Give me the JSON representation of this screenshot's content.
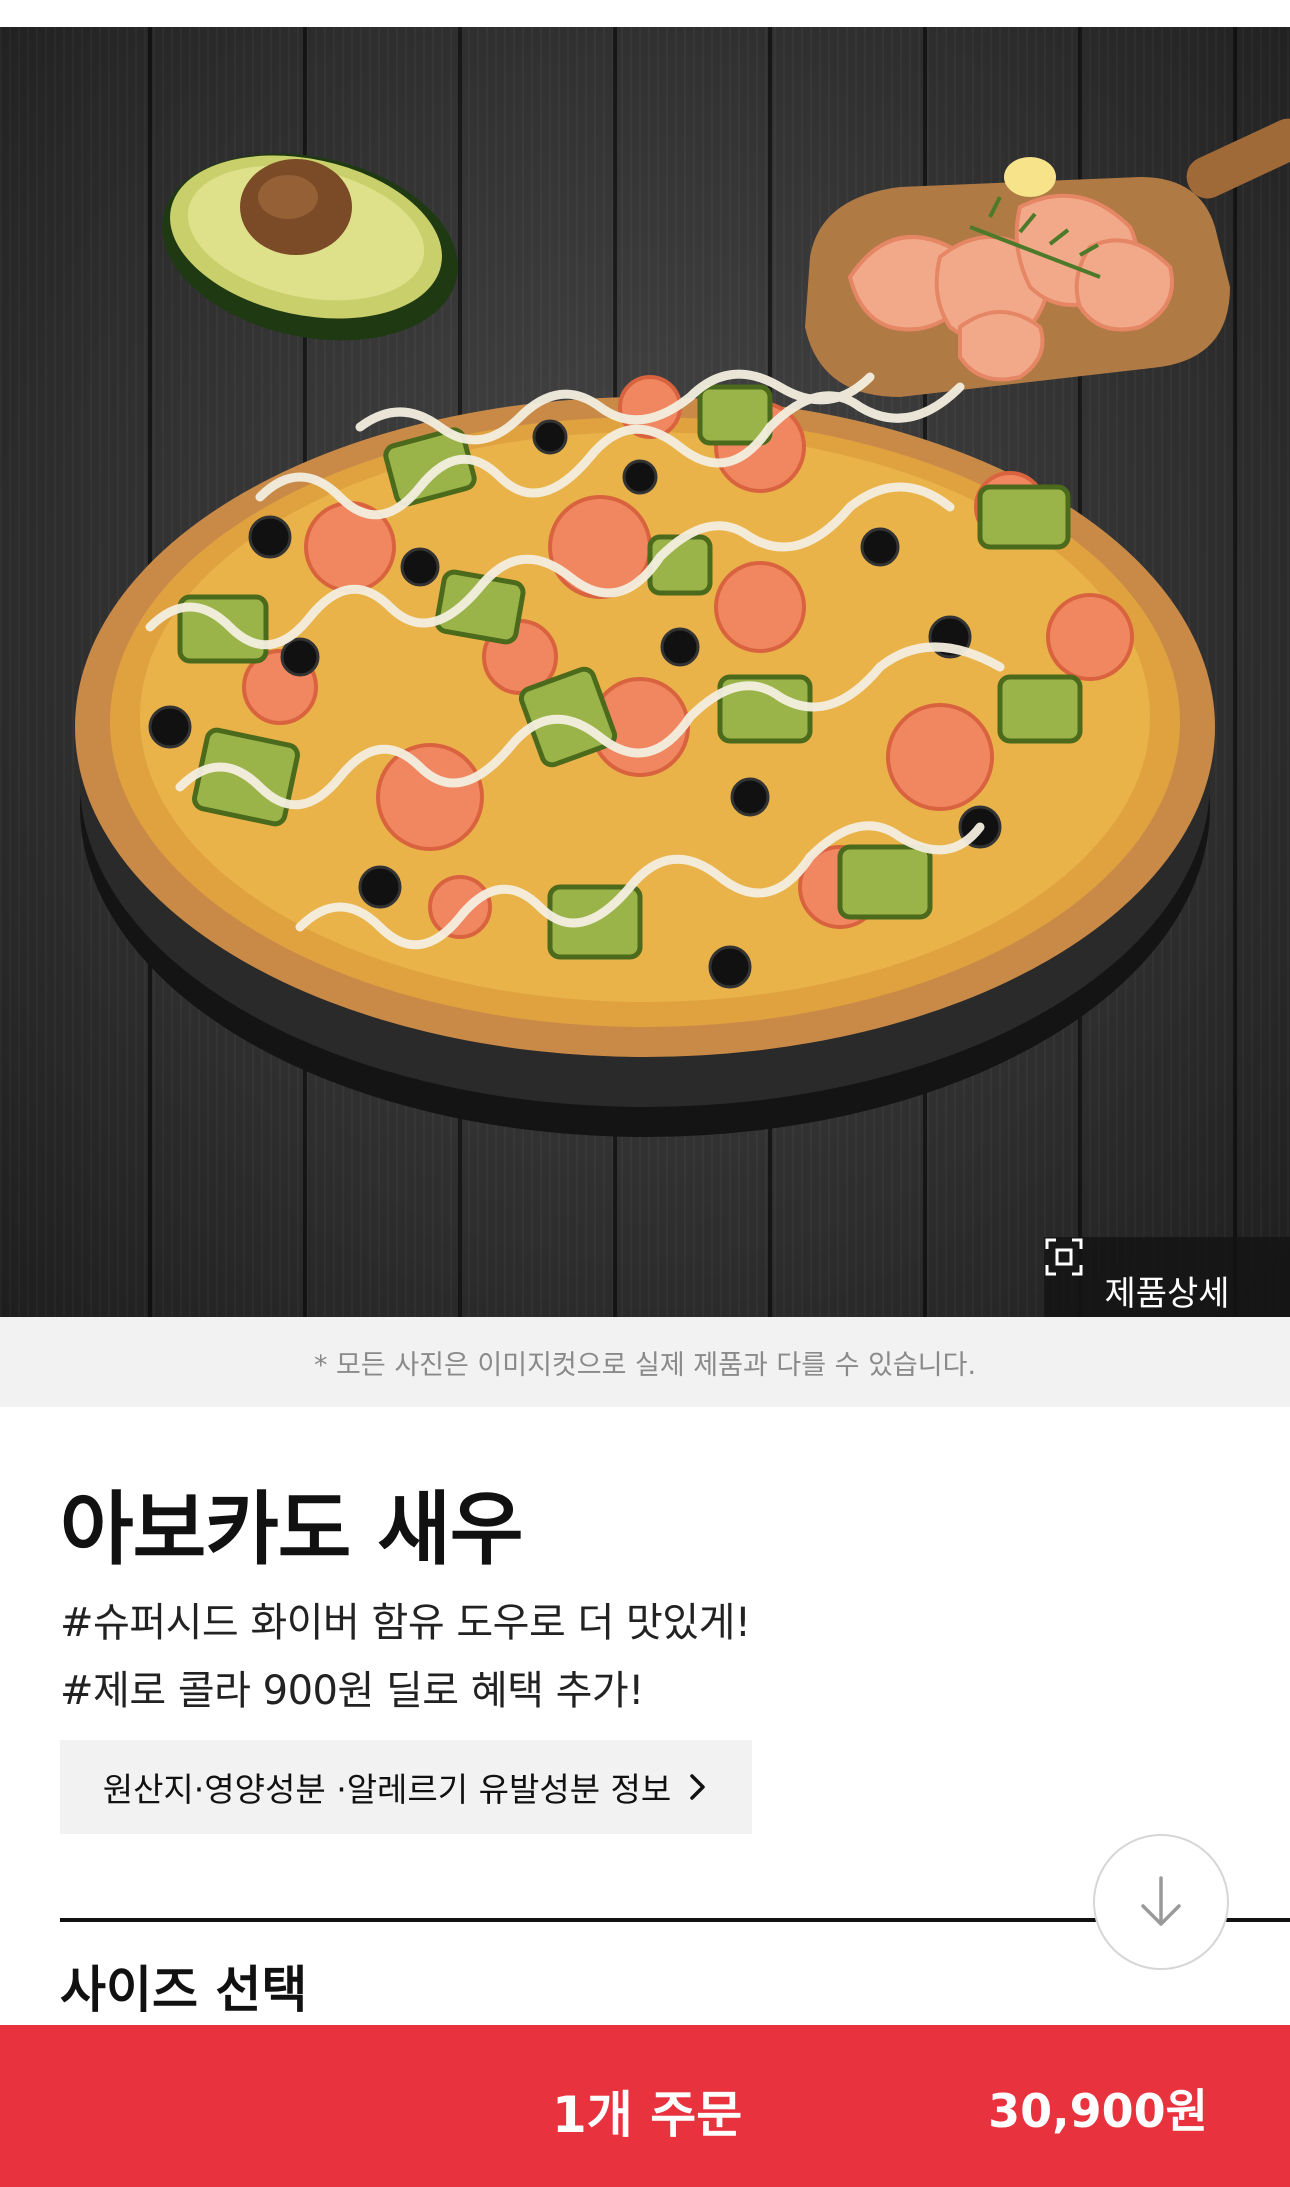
{
  "hero": {
    "image_icon": "pizza-photo",
    "detail_button": {
      "label": "제품상세",
      "icon": "frame-icon"
    }
  },
  "notice": "* 모든 사진은 이미지컷으로 실제 제품과 다를 수 있습니다.",
  "product": {
    "name": "아보카도 새우",
    "tags": [
      "#슈퍼시드 화이버 함유 도우로 더 맛있게!",
      "#제로 콜라 900원 딜로 혜택 추가!"
    ],
    "info_button": {
      "label": "원산지·영양성분 ·알레르기 유발성분 정보",
      "icon": "chevron-right-icon"
    }
  },
  "scroll_button": {
    "icon": "arrow-down-icon"
  },
  "size_section": {
    "title": "사이즈 선택"
  },
  "order_bar": {
    "label": "1개 주문",
    "price": "30,900원",
    "color": "#e8323e"
  }
}
